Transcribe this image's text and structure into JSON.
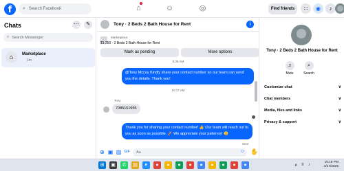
{
  "topbar": {
    "logo": "f",
    "search_placeholder": "Search Facebook",
    "find_friends": "Find friends"
  },
  "left": {
    "title": "Chats",
    "search_placeholder": "Search Messenger",
    "conversation": {
      "name": "Marketplace",
      "time": "1m"
    }
  },
  "chat": {
    "title": "Tony · 2 Beds 2 Bath House for Rent",
    "pinned_label": "Marketplace",
    "pinned_detail": "$1,250 · 2 Beds 2 Bath House for Rent",
    "mark_pending": "Mark as pending",
    "more_options": "More options",
    "timestamp_1": "5:35 AM",
    "message_1": "@Tony Mccoy Kindly share your contact number so our team can send you the details. Thank you!",
    "timestamp_2": "10:17 AM",
    "sender": "Tony",
    "message_2": "7085151955",
    "message_3": "Thank you for sharing your contact number! 👍 Our team will reach out to you as soon as possible. 🚀 We appreciate your patience! 😊",
    "sent_label": "Sent",
    "composer_placeholder": "Aa"
  },
  "right": {
    "title": "Tony · 2 Beds 2 Bath House for Rent",
    "mute": "Mute",
    "search": "Search",
    "rows": [
      "Customize chat",
      "Chat members",
      "Media, files and links",
      "Privacy & support"
    ]
  },
  "taskbar": {
    "time": "10:18 PM",
    "date": "3/17/2025"
  },
  "colors": {
    "accent": "#0866ff",
    "bubble_in": "#e4e6eb",
    "selected": "#e9f0fb"
  },
  "icons": [
    "facebook-logo",
    "search-icon",
    "home-icon",
    "friends-icon",
    "groups-icon",
    "menu-grid-icon",
    "messenger-icon",
    "bell-icon",
    "info-icon",
    "plus-icon",
    "image-icon",
    "sticker-icon",
    "gif-icon",
    "emoji-icon",
    "like-icon",
    "mute-icon",
    "chevron-down-icon",
    "windows-icon"
  ]
}
